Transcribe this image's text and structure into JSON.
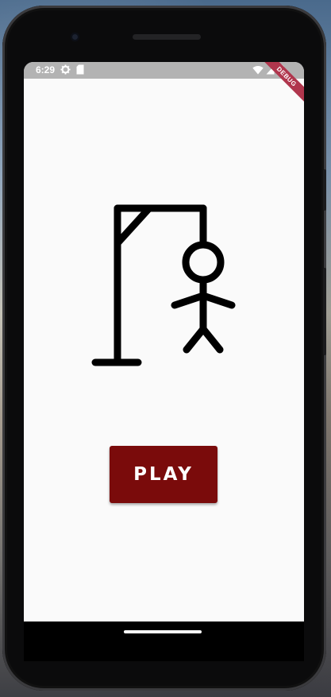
{
  "status_bar": {
    "time": "6:29",
    "icons": [
      "gear-icon",
      "sd-card-icon",
      "wifi-icon",
      "signal-icon",
      "battery-icon"
    ],
    "debug_banner": "DEBUG"
  },
  "main": {
    "illustration": "hangman-gallows-stick-figure",
    "play_button_label": "PLAY"
  },
  "colors": {
    "background": "#fafafa",
    "play_button": "#7a0b0b",
    "status_bar": "#b3b3b3",
    "debug_ribbon": "#b0364d"
  }
}
